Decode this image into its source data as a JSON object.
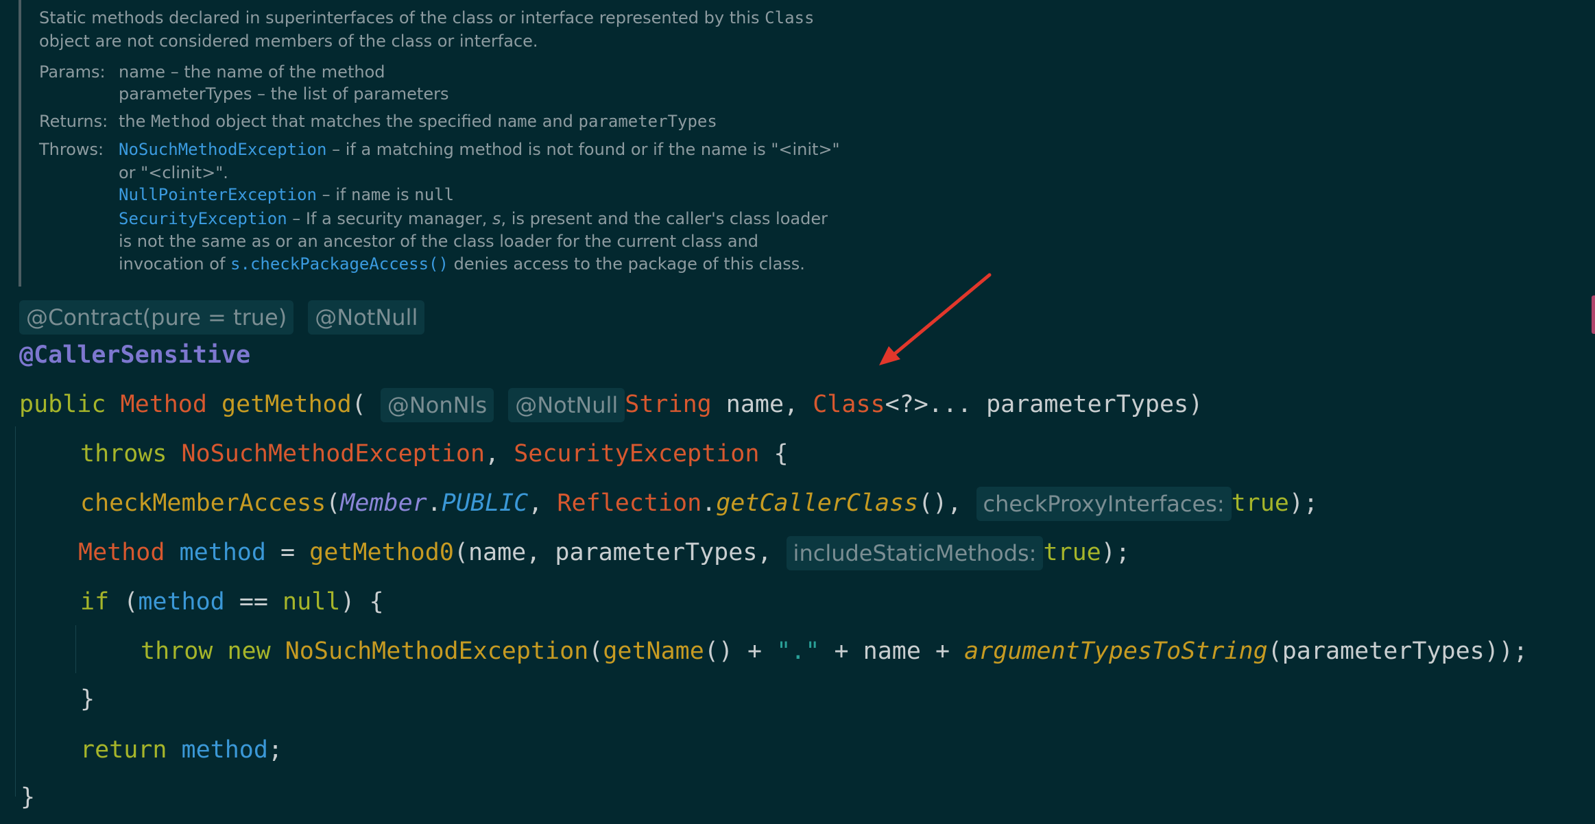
{
  "doc": {
    "desc_line1_a": "Static methods declared in superinterfaces of the class or interface represented by this",
    "desc_line1_code": "Class",
    "desc_line2": "object are not considered members of the class or interface.",
    "params_label": "Params:",
    "params_line1": "name – the name of the method",
    "params_line2": "parameterTypes – the list of parameters",
    "returns_label": "Returns:",
    "returns_a": "the",
    "returns_code1": "Method",
    "returns_b": "object that matches the specified",
    "returns_code2": "name",
    "returns_c": "and",
    "returns_code3": "parameterTypes",
    "throws_label": "Throws:",
    "throws1_link": "NoSuchMethodException",
    "throws1_text": "– if a matching method is not found or if the name is \"<init>\"",
    "throws1_cont": "or \"<clinit>\".",
    "throws2_link": "NullPointerException",
    "throws2_text": "– if",
    "throws2_code": "name",
    "throws2_tail": "is",
    "throws2_code2": "null",
    "throws3_link": "SecurityException",
    "throws3_text_a": "– If a security manager,",
    "throws3_s": "s",
    "throws3_text_b": ", is present and the caller's class loader",
    "throws3_line2": "is not the same as or an ancestor of the class loader for the current class and",
    "throws3_line3_a": "invocation of",
    "throws3_line3_link": "s.checkPackageAccess()",
    "throws3_line3_b": "denies access to the package of this class."
  },
  "code": {
    "inferred_ann1": "@Contract(pure = true)",
    "inferred_ann2": "@NotNull",
    "annotation": "@CallerSensitive",
    "l1_public": "public",
    "l1_type": "Method",
    "l1_name": "getMethod",
    "l1_paren": "(",
    "l1_hint1": "@NonNls",
    "l1_hint2": "@NotNull",
    "l1_string": "String",
    "l1_name_param": " name, ",
    "l1_class": "Class",
    "l1_rest": "<?>... parameterTypes)",
    "l2_throws": "throws",
    "l2_ex1": "NoSuchMethodException",
    "l2_comma": ", ",
    "l2_ex2": "SecurityException",
    "l2_brace": " {",
    "l3_call": "checkMemberAccess",
    "l3_paren": "(",
    "l3_member": "Member",
    "l3_dot": ".",
    "l3_public": "PUBLIC",
    "l3_comma": ", ",
    "l3_reflection": "Reflection",
    "l3_dot2": ".",
    "l3_getcaller": "getCallerClass",
    "l3_after": "(), ",
    "l3_hint": "checkProxyInterfaces:",
    "l3_true": "true",
    "l3_end": ");",
    "l4_type": "Method",
    "l4_var": "method",
    "l4_eq": " = ",
    "l4_call": "getMethod0",
    "l4_args": "(name, parameterTypes, ",
    "l4_hint": "includeStaticMethods:",
    "l4_true": "true",
    "l4_end": ");",
    "l5_if": "if",
    "l5_open": " (",
    "l5_var": "method",
    "l5_eq": " == ",
    "l5_null": "null",
    "l5_close": ") {",
    "l6_throw": "throw",
    "l6_new": "new",
    "l6_ex": "NoSuchMethodException",
    "l6_open": "(",
    "l6_getname": "getName",
    "l6_plus1": "() + ",
    "l6_str": "\".\"",
    "l6_plus2": " + name + ",
    "l6_argfn": "argumentTypesToString",
    "l6_tail": "(parameterTypes));",
    "l7_brace": "}",
    "l8_return": "return",
    "l8_var": "method",
    "l8_semi": ";",
    "l9_brace": "}"
  },
  "colors": {
    "background": "#03282f",
    "keyword": "#a6b52a",
    "type": "#d8582f",
    "function": "#c79b22",
    "variable": "#3b98d7",
    "annotation": "#7d77cf",
    "string": "#2aa198",
    "arrow": "#e2372b"
  },
  "icons": {
    "annotation_arrow": "red-arrow-icon"
  }
}
